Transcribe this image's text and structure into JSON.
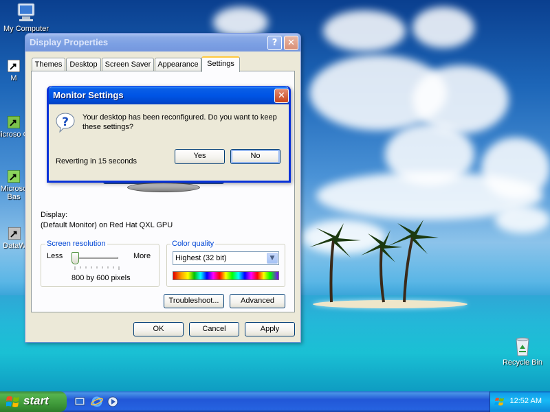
{
  "desktop": {
    "icons": [
      {
        "label": "My Computer"
      },
      {
        "label": "M"
      },
      {
        "label": "Microso C+"
      },
      {
        "label": "Microso Bas"
      },
      {
        "label": "DataW"
      },
      {
        "label": "Recycle Bin"
      }
    ]
  },
  "display_properties": {
    "title": "Display Properties",
    "tabs": [
      "Themes",
      "Desktop",
      "Screen Saver",
      "Appearance",
      "Settings"
    ],
    "selected_tab": "Settings",
    "display_label": "Display:",
    "display_value": "(Default Monitor) on Red Hat QXL GPU",
    "screen_resolution": {
      "title": "Screen resolution",
      "less_label": "Less",
      "more_label": "More",
      "value_text": "800 by 600 pixels",
      "slider_position": 0
    },
    "color_quality": {
      "title": "Color quality",
      "selected": "Highest (32 bit)"
    },
    "troubleshoot_label": "Troubleshoot...",
    "advanced_label": "Advanced",
    "ok_label": "OK",
    "cancel_label": "Cancel",
    "apply_label": "Apply"
  },
  "monitor_settings": {
    "title": "Monitor Settings",
    "message": "Your desktop has been reconfigured.  Do you want to keep these settings?",
    "countdown": "Reverting in 15 seconds",
    "yes_label": "Yes",
    "no_label": "No",
    "icon": "question-icon"
  },
  "taskbar": {
    "start_label": "start",
    "quick_launch": [
      "show-desktop-icon",
      "internet-explorer-icon",
      "media-player-icon"
    ],
    "clock": "12:52 AM"
  },
  "colors": {
    "title_active": "#0055e5",
    "title_inactive": "#7b9fe3",
    "start_green": "#3f9a3a",
    "group_title": "#0046d5"
  }
}
